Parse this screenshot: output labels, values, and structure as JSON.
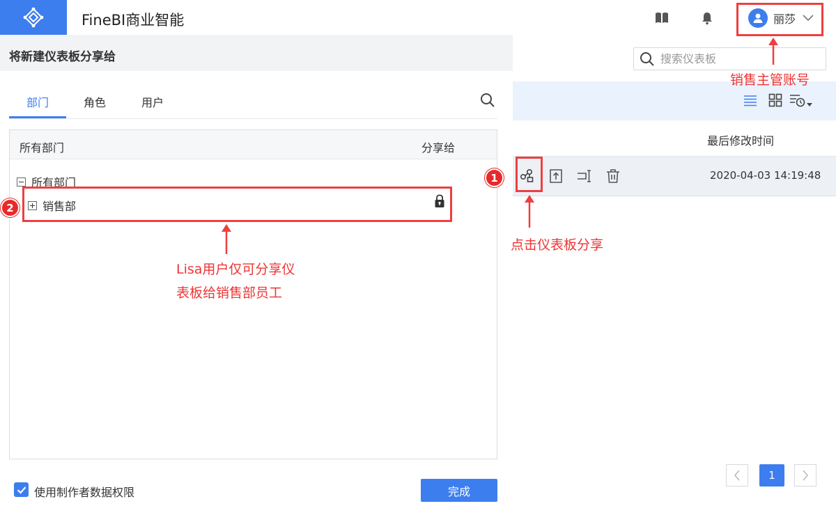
{
  "app": {
    "title": "FineBI商业智能"
  },
  "topbar": {
    "user_name": "丽莎"
  },
  "dashboard": {
    "search_placeholder": "搜索仪表板",
    "column_header": "最后修改时间",
    "row": {
      "modified_time": "2020-04-03 14:19:48"
    },
    "pager": {
      "current_page": "1"
    }
  },
  "modal": {
    "title": "将新建仪表板分享给",
    "tabs": [
      {
        "label": "部门"
      },
      {
        "label": "角色"
      },
      {
        "label": "用户"
      }
    ],
    "tree_header": {
      "left": "所有部门",
      "right": "分享给"
    },
    "tree": {
      "root": "所有部门",
      "child": "销售部"
    },
    "checkbox_label": "使用制作者数据权限",
    "done_label": "完成"
  },
  "annotations": {
    "account_label": "销售主管账号",
    "share_label": "点击仪表板分享",
    "lisa_line1": "Lisa用户仅可分享仪",
    "lisa_line2": "表板给销售部员工",
    "num1": "1",
    "num2": "2"
  },
  "colors": {
    "accent": "#3d7eee",
    "annotation": "#ee3f3f"
  }
}
